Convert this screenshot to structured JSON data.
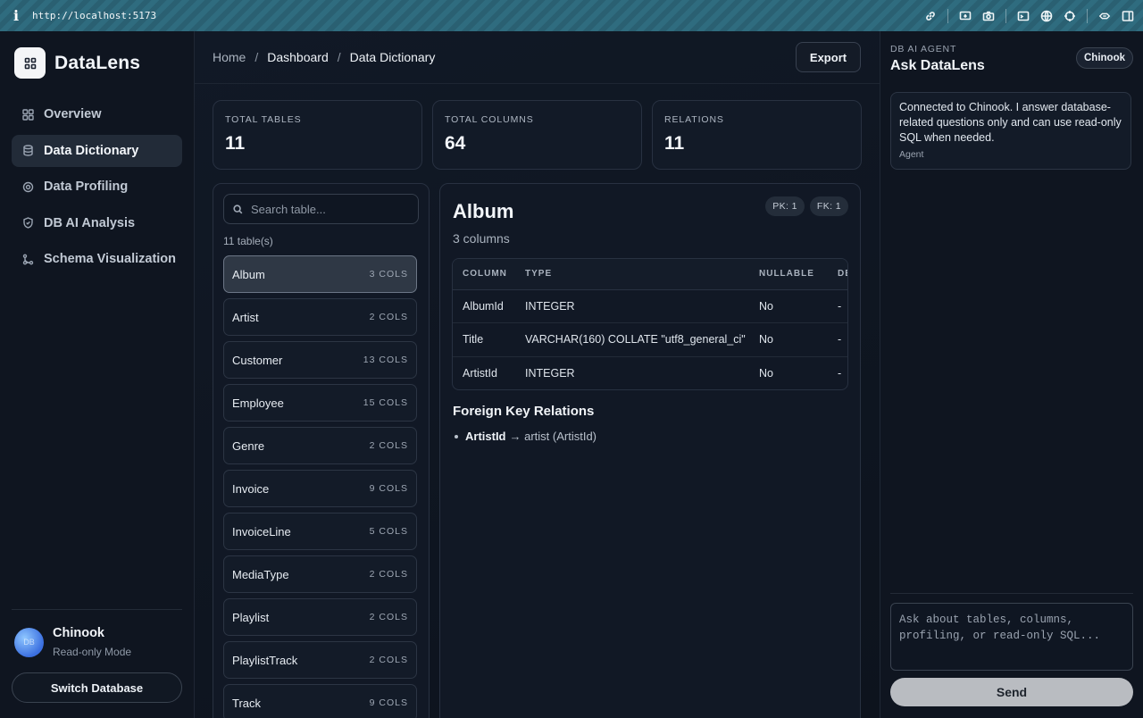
{
  "browser": {
    "url": "http://localhost:5173"
  },
  "app": {
    "name": "DataLens"
  },
  "nav": [
    {
      "label": "Overview",
      "icon": "grid-icon"
    },
    {
      "label": "Data Dictionary",
      "icon": "database-icon"
    },
    {
      "label": "Data Profiling",
      "icon": "target-icon"
    },
    {
      "label": "DB AI Analysis",
      "icon": "shield-icon"
    },
    {
      "label": "Schema Visualization",
      "icon": "schema-icon"
    }
  ],
  "db": {
    "name": "Chinook",
    "mode": "Read-only Mode",
    "switch_label": "Switch Database"
  },
  "breadcrumb": {
    "home": "Home",
    "dashboard": "Dashboard",
    "current": "Data Dictionary"
  },
  "export_label": "Export",
  "stats": [
    {
      "label": "TOTAL TABLES",
      "value": "11"
    },
    {
      "label": "TOTAL COLUMNS",
      "value": "64"
    },
    {
      "label": "RELATIONS",
      "value": "11"
    }
  ],
  "search": {
    "placeholder": "Search table..."
  },
  "tables_count": "11 table(s)",
  "tables": [
    {
      "name": "Album",
      "cols": "3 COLS"
    },
    {
      "name": "Artist",
      "cols": "2 COLS"
    },
    {
      "name": "Customer",
      "cols": "13 COLS"
    },
    {
      "name": "Employee",
      "cols": "15 COLS"
    },
    {
      "name": "Genre",
      "cols": "2 COLS"
    },
    {
      "name": "Invoice",
      "cols": "9 COLS"
    },
    {
      "name": "InvoiceLine",
      "cols": "5 COLS"
    },
    {
      "name": "MediaType",
      "cols": "2 COLS"
    },
    {
      "name": "Playlist",
      "cols": "2 COLS"
    },
    {
      "name": "PlaylistTrack",
      "cols": "2 COLS"
    },
    {
      "name": "Track",
      "cols": "9 COLS"
    }
  ],
  "detail": {
    "title": "Album",
    "subtitle": "3 columns",
    "pk": "PK: 1",
    "fk": "FK: 1",
    "headers": {
      "column": "COLUMN",
      "type": "TYPE",
      "nullable": "NULLABLE",
      "default": "DEF"
    },
    "rows": [
      {
        "column": "AlbumId",
        "type": "INTEGER",
        "nullable": "No",
        "default": "-"
      },
      {
        "column": "Title",
        "type": "VARCHAR(160) COLLATE \"utf8_general_ci\"",
        "nullable": "No",
        "default": "-"
      },
      {
        "column": "ArtistId",
        "type": "INTEGER",
        "nullable": "No",
        "default": "-"
      }
    ],
    "fk_heading": "Foreign Key Relations",
    "fk_relations": [
      {
        "column": "ArtistId",
        "target": "→ artist (ArtistId)"
      }
    ]
  },
  "agent": {
    "label": "DB AI AGENT",
    "title": "Ask DataLens",
    "db_chip": "Chinook",
    "message": "Connected to Chinook. I answer database-related questions only and can use read-only SQL when needed.",
    "sender": "Agent",
    "input_placeholder": "Ask about tables, columns, profiling, or read-only SQL...",
    "send_label": "Send"
  }
}
